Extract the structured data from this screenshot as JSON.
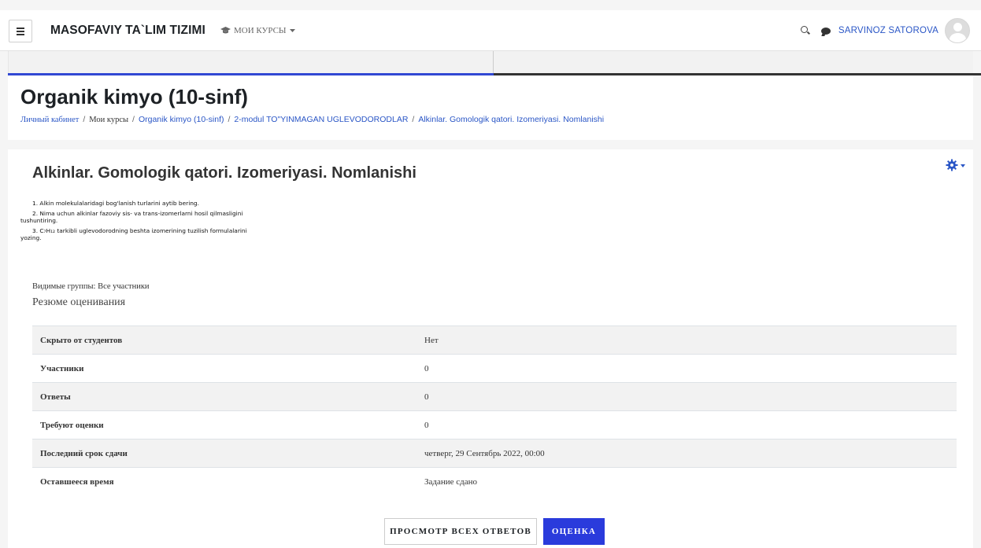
{
  "navbar": {
    "brand": "MASOFAVIY TA`LIM TIZIMI",
    "my_courses": "МОИ КУРСЫ",
    "user_name": "SARVINOZ SATOROVA",
    "icons": [
      "hamburger-icon",
      "graduation-cap-icon",
      "chevron-down-icon",
      "search-icon",
      "chat-icon",
      "avatar"
    ]
  },
  "course": {
    "title": "Organik kimyo (10-sinf)"
  },
  "breadcrumb": {
    "items": [
      "Личный кабинет",
      "Мои курсы",
      "Organik kimyo (10-sinf)",
      "2-modul TO\"YINMAGAN UGLEVODORODLAR",
      "Alkinlar. Gomologik qatori. Izomeriyasi. Nomlanishi"
    ],
    "separator": "/"
  },
  "activity": {
    "title": "Alkinlar. Gomologik qatori. Izomeriyasi. Nomlanishi",
    "questions": [
      {
        "first": "1. Alkin molekulalaridagi bog'lanish turlarini aytib bering.",
        "rest": ""
      },
      {
        "first": "2. Nima uchun alkinlar fazoviy sis- va trans-izomerlarni hosil qilmasligini",
        "rest": "tushuntiring."
      },
      {
        "first": "3. C₇H₁₂ tarkibli uglevodorodning beshta izomerining tuzilish formulalarini",
        "rest": "yozing."
      }
    ],
    "visible_groups": "Видимые группы: Все участники",
    "summary_title": "Резюме оценивания"
  },
  "grading_summary": [
    {
      "label": "Скрыто от студентов",
      "value": "Нет"
    },
    {
      "label": "Участники",
      "value": "0"
    },
    {
      "label": "Ответы",
      "value": "0"
    },
    {
      "label": "Требуют оценки",
      "value": "0"
    },
    {
      "label": "Последний срок сдачи",
      "value": "четверг, 29 Сентябрь 2022, 00:00"
    },
    {
      "label": "Оставшееся время",
      "value": "Задание сдано"
    }
  ],
  "buttons": {
    "view_all": "ПРОСМОТР ВСЕХ ОТВЕТОВ",
    "grade": "ОЦЕНКА"
  },
  "colors": {
    "accent": "#2a3bdc",
    "link": "#2a56c6"
  }
}
